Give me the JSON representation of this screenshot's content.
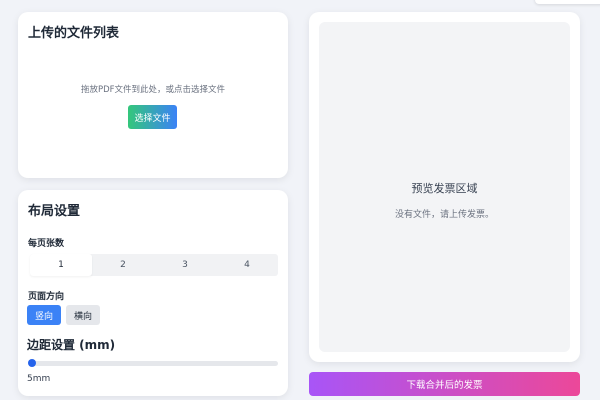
{
  "upload": {
    "title": "上传的文件列表",
    "dropzone_text": "拖放PDF文件到此处，或点击选择文件",
    "choose_button": "选择文件"
  },
  "layout": {
    "title": "布局设置",
    "pages_per_sheet_label": "每页张数",
    "pages_per_sheet_options": [
      "1",
      "2",
      "3",
      "4"
    ],
    "pages_per_sheet_selected": "1",
    "orientation_label": "页面方向",
    "orientation_options": [
      "竖向",
      "横向"
    ],
    "orientation_selected": "竖向",
    "margin_label": "边距设置 (mm)",
    "margin_value": "5mm"
  },
  "preview": {
    "title": "预览发票区域",
    "empty_text": "没有文件，请上传发票。"
  },
  "download_button": "下载合并后的发票",
  "colors": {
    "primary": "#3b82f6",
    "choose_gradient": [
      "#34c77b",
      "#3b82f6"
    ],
    "download_gradient": [
      "#a855f7",
      "#ec4899"
    ]
  }
}
